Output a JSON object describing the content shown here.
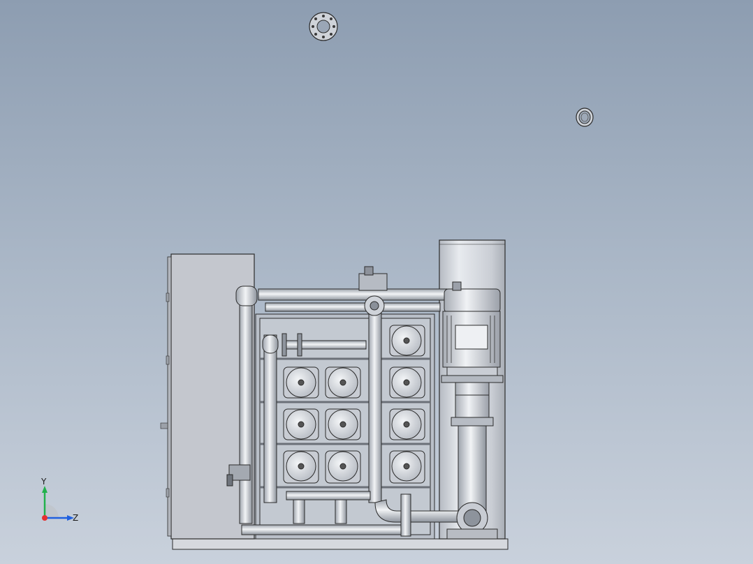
{
  "viewport": {
    "background_top": "#8d9db1",
    "background_bottom": "#c9d1dc"
  },
  "model": {
    "metal_color": "#d4d8de",
    "edge_color": "#2b2b2b",
    "panel_color": "#c4c7ce"
  },
  "triad": {
    "x_axis_color": "#e53030",
    "y_axis_color": "#22b14c",
    "z_axis_color": "#2060e0",
    "y_label": "Y",
    "z_label": "Z"
  },
  "icons": {
    "flange": "flange-icon",
    "ring": "ring-icon",
    "triad": "axis-triad-icon"
  }
}
